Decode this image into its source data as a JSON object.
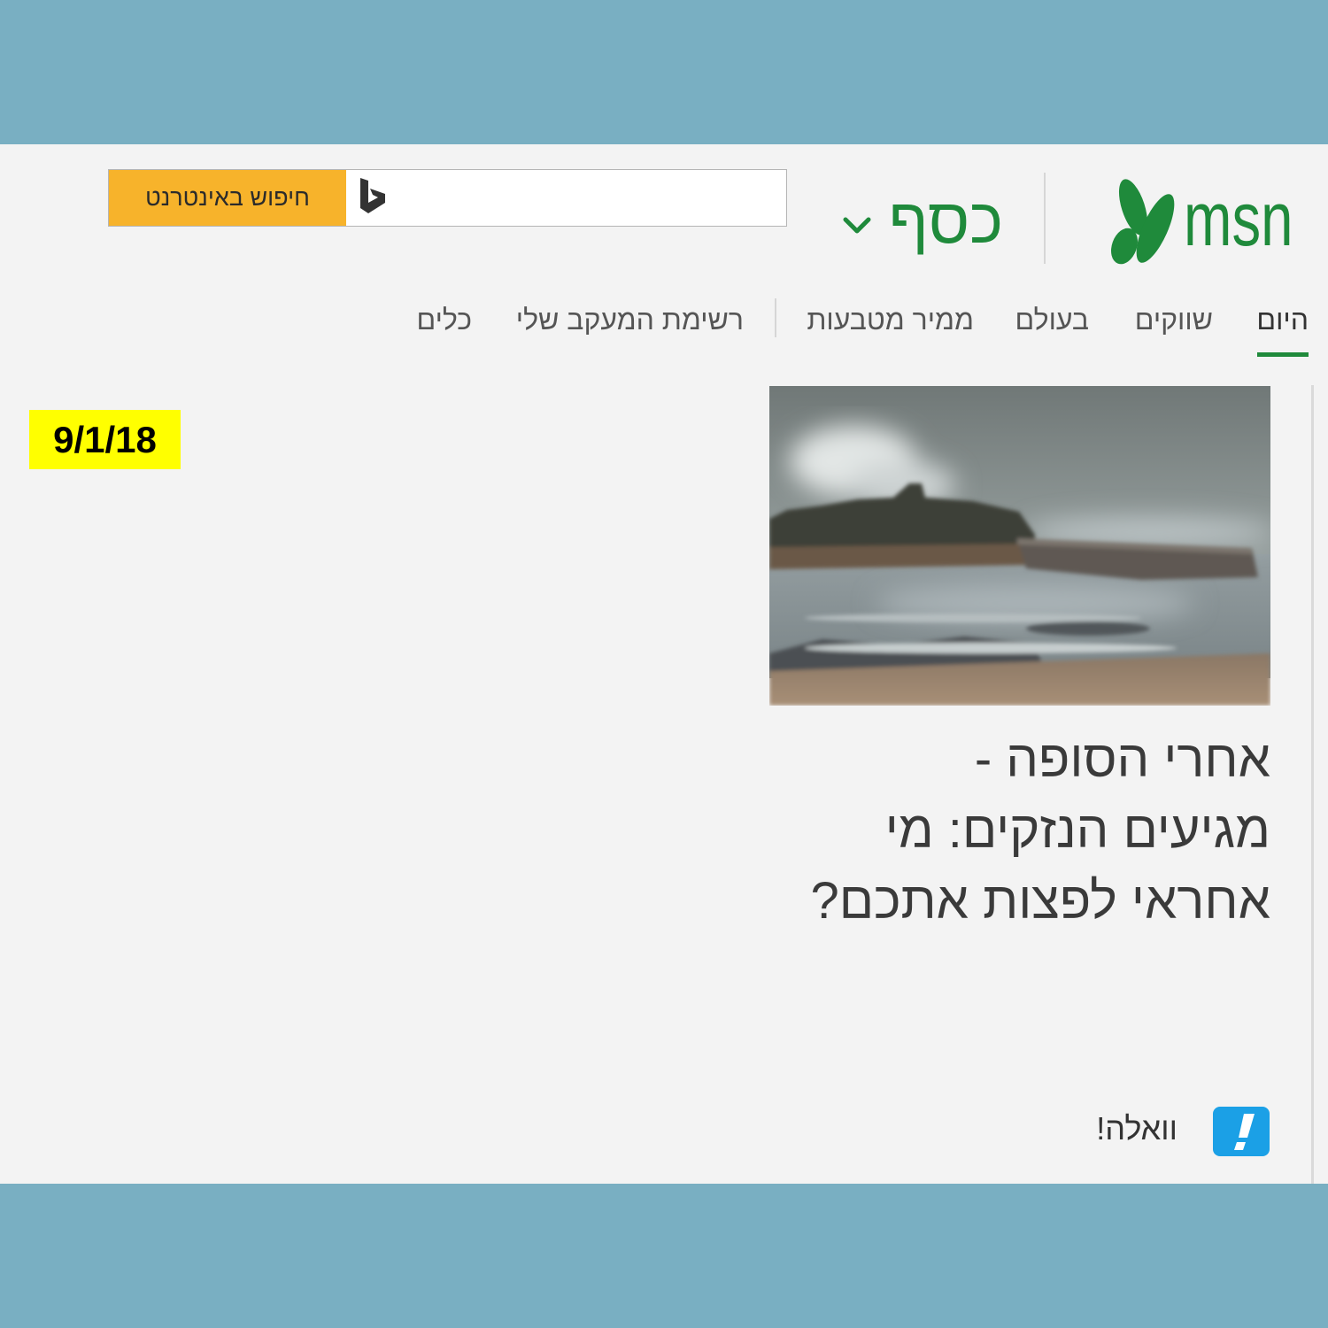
{
  "colors": {
    "brand_green": "#1f8a3b",
    "search_button": "#f7b32b",
    "walla_blue": "#1ba0e6",
    "date_badge_bg": "#ffff00",
    "frame_blue": "#79afc2",
    "page_bg": "#f3f3f3"
  },
  "header": {
    "logo_text": "msn",
    "logo_icon": "msn-butterfly-icon",
    "section_label": "כסף",
    "section_dropdown_icon": "chevron-down-icon"
  },
  "search": {
    "button_label": "חיפוש באינטרנט",
    "engine_icon": "bing-icon",
    "value": ""
  },
  "nav": {
    "tabs": [
      {
        "label": "היום",
        "active": true
      },
      {
        "label": "שווקים",
        "active": false
      },
      {
        "label": "בעולם",
        "active": false
      },
      {
        "label": "ממיר מטבעות",
        "active": false
      },
      {
        "label": "רשימת המעקב שלי",
        "active": false
      },
      {
        "label": "כלים",
        "active": false
      }
    ]
  },
  "article": {
    "headline_lines": [
      "אחרי הסופה -",
      "מגיעים הנזקים: מי",
      "אחראי לפצות אתכם?"
    ],
    "source": {
      "name": "וואלה!",
      "logo_icon": "walla-logo-icon"
    }
  },
  "date_badge": {
    "text": "9/1/18"
  }
}
